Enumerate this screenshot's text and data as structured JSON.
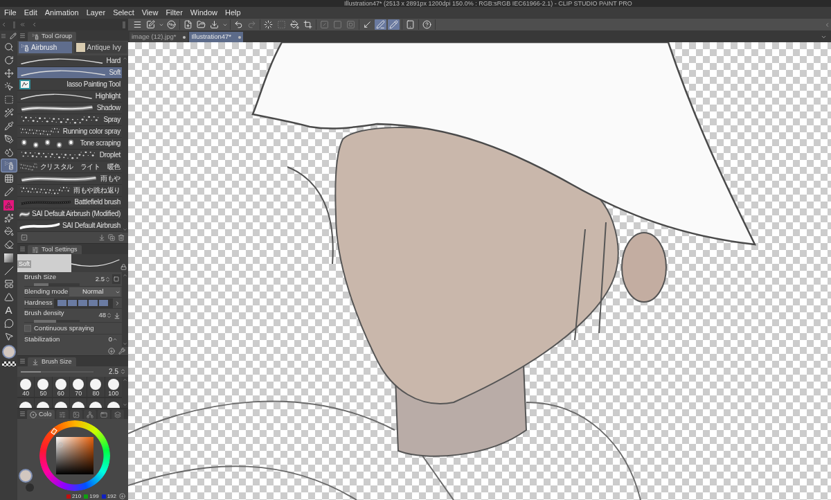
{
  "window": {
    "title": "Illustration47* (2513 x 2891px 1200dpi 150.0% : RGB:sRGB IEC61966-2.1)  - CLIP STUDIO PAINT PRO"
  },
  "menu": [
    "File",
    "Edit",
    "Animation",
    "Layer",
    "Select",
    "View",
    "Filter",
    "Window",
    "Help"
  ],
  "toolbar": [
    [
      {
        "kind": "menu",
        "selected": false,
        "disabled": false
      },
      {
        "kind": "edit",
        "selected": false,
        "disabled": false
      },
      {
        "kind": "caret",
        "selected": false,
        "disabled": false
      },
      {
        "kind": "swirl",
        "selected": false,
        "disabled": false
      }
    ],
    [
      {
        "kind": "new",
        "selected": false,
        "disabled": false
      },
      {
        "kind": "open",
        "selected": false,
        "disabled": false
      },
      {
        "kind": "export",
        "selected": false,
        "disabled": false
      },
      {
        "kind": "caret",
        "selected": false,
        "disabled": false
      }
    ],
    [
      {
        "kind": "undo",
        "selected": false,
        "disabled": false
      },
      {
        "kind": "redo",
        "selected": false,
        "disabled": true
      }
    ],
    [
      {
        "kind": "marquee",
        "selected": false,
        "disabled": false
      },
      {
        "kind": "deselect",
        "selected": false,
        "disabled": true
      },
      {
        "kind": "fill",
        "selected": false,
        "disabled": false
      },
      {
        "kind": "crop",
        "selected": false,
        "disabled": false
      }
    ],
    [
      {
        "kind": "diagonal",
        "selected": false,
        "disabled": true
      },
      {
        "kind": "halfsquare",
        "selected": false,
        "disabled": true
      },
      {
        "kind": "roundsquare",
        "selected": false,
        "disabled": true
      }
    ],
    [
      {
        "kind": "corner",
        "selected": false,
        "disabled": false
      },
      {
        "kind": "pen",
        "selected": true,
        "disabled": false
      },
      {
        "kind": "pencurve",
        "selected": true,
        "disabled": false
      }
    ],
    [
      {
        "kind": "tablet",
        "selected": false,
        "disabled": false
      }
    ],
    [
      {
        "kind": "help",
        "selected": false,
        "disabled": false
      }
    ]
  ],
  "document_tabs": [
    {
      "label": "image (12).jpg*",
      "selected": false
    },
    {
      "label": "Illustration47*",
      "selected": true
    }
  ],
  "tools": [
    {
      "kind": "zoom",
      "selected": false
    },
    {
      "kind": "rotate",
      "selected": false
    },
    {
      "kind": "move",
      "selected": false
    },
    {
      "kind": "layer",
      "selected": false
    },
    {
      "kind": "marquee",
      "selected": false
    },
    {
      "kind": "wand",
      "selected": false
    },
    {
      "kind": "eyedropper",
      "selected": false
    },
    {
      "kind": "pen",
      "selected": false
    },
    {
      "kind": "blend",
      "selected": false
    },
    {
      "kind": "airbrush",
      "selected": true
    },
    {
      "kind": "decoration",
      "selected": false
    },
    {
      "kind": "pencil",
      "selected": false
    },
    {
      "kind": "figure",
      "selected": false
    },
    {
      "kind": "sparkle",
      "selected": false
    },
    {
      "kind": "fill",
      "selected": false
    },
    {
      "kind": "eraser",
      "selected": false
    },
    {
      "kind": "gradient",
      "selected": false
    },
    {
      "kind": "line",
      "selected": false
    },
    {
      "kind": "frame",
      "selected": false
    },
    {
      "kind": "ruler",
      "selected": false
    },
    {
      "kind": "text",
      "glyph": "A",
      "selected": false
    },
    {
      "kind": "balloon",
      "selected": false
    },
    {
      "kind": "object",
      "selected": false
    }
  ],
  "tool_group": {
    "title": "Tool Group",
    "tabs": [
      {
        "label": "Airbrush",
        "selected": true
      },
      {
        "label": "Antique Ivy",
        "selected": false
      }
    ],
    "sub_tools": [
      {
        "label": "Hard",
        "kind": "line",
        "selected": false
      },
      {
        "label": "Soft",
        "kind": "line",
        "selected": true
      },
      {
        "label": "lasso Painting Tool",
        "kind": "image",
        "selected": false
      },
      {
        "label": "Highlight",
        "kind": "line",
        "selected": false
      },
      {
        "label": "Shadow",
        "kind": "glow",
        "selected": false
      },
      {
        "label": "Spray",
        "kind": "spray",
        "selected": false
      },
      {
        "label": "Running color spray",
        "kind": "spray",
        "selected": false
      },
      {
        "label": "Tone scraping",
        "kind": "dots",
        "selected": false
      },
      {
        "label": "Droplet",
        "kind": "spray",
        "selected": false
      },
      {
        "label": "クリスタル　ライト　暖色",
        "kind": "spray",
        "selected": false
      },
      {
        "label": "雨もや",
        "kind": "glow",
        "selected": false
      },
      {
        "label": "雨もや跳ね返り",
        "kind": "spray",
        "selected": false
      },
      {
        "label": "Battlefield brush",
        "kind": "dark",
        "selected": false
      },
      {
        "label": "SAI Default Airbrush (Modified)",
        "kind": "glow",
        "selected": false
      },
      {
        "label": "SAI Default Airbrush",
        "kind": "thick",
        "selected": false
      }
    ]
  },
  "tool_settings": {
    "title": "Tool Settings",
    "preview_label": "Soft",
    "brush_size": {
      "label": "Brush Size",
      "value": "2.5",
      "level": 0.32
    },
    "blending_mode": {
      "label": "Blending mode",
      "value": "Normal"
    },
    "hardness": {
      "label": "Hardness",
      "level": 1
    },
    "brush_density": {
      "label": "Brush density",
      "value": "48",
      "level": 0.48
    },
    "continuous_spraying": {
      "label": "Continuous spraying",
      "checked": false
    },
    "stabilization": {
      "label": "Stabilization",
      "value": "0"
    }
  },
  "brush_size_panel": {
    "title": "Brush Size",
    "value": "2.5",
    "level": 0.28,
    "presets": [
      "40",
      "50",
      "60",
      "70",
      "80",
      "100"
    ]
  },
  "color_panel": {
    "tabs": [
      {
        "label": "Colo",
        "kind": "wheel",
        "selected": true
      },
      {
        "kind": "sliders",
        "selected": false
      },
      {
        "kind": "image",
        "selected": false
      },
      {
        "kind": "network",
        "selected": false
      },
      {
        "kind": "window",
        "selected": false
      },
      {
        "kind": "layers",
        "selected": false
      }
    ],
    "rgb": [
      "210",
      "199",
      "192"
    ]
  }
}
